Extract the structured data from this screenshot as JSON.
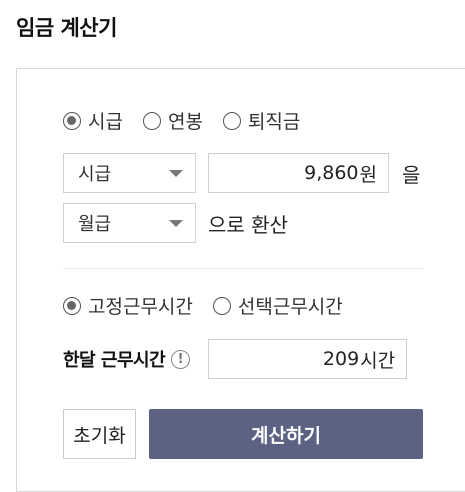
{
  "title": "임금 계산기",
  "pay_type": {
    "options": [
      {
        "label": "시급",
        "selected": true
      },
      {
        "label": "연봉",
        "selected": false
      },
      {
        "label": "퇴직금",
        "selected": false
      }
    ]
  },
  "from": {
    "unit_select": "시급",
    "amount": "9,860",
    "currency": "원",
    "particle": "을"
  },
  "to": {
    "unit_select": "월급",
    "suffix": "으로 환산"
  },
  "work_type": {
    "options": [
      {
        "label": "고정근무시간",
        "selected": true
      },
      {
        "label": "선택근무시간",
        "selected": false
      }
    ]
  },
  "monthly_hours": {
    "label": "한달 근무시간",
    "info_icon": "!",
    "value": "209",
    "unit": "시간"
  },
  "buttons": {
    "reset": "초기화",
    "calculate": "계산하기"
  },
  "colors": {
    "primary_button": "#5b6283",
    "border": "#d0d0d0"
  }
}
